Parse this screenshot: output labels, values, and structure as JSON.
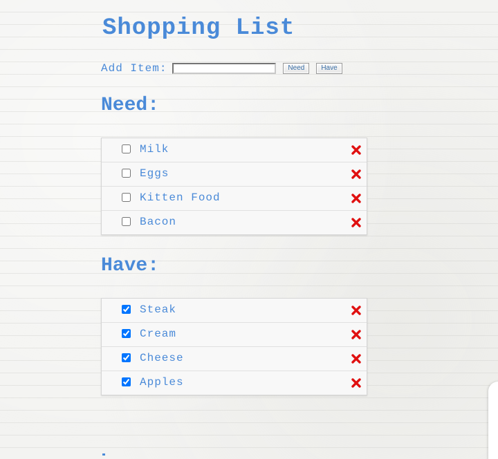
{
  "title": "Shopping List",
  "add_form": {
    "label": "Add Item:",
    "input_value": "",
    "need_button": "Need",
    "have_button": "Have"
  },
  "need": {
    "heading": "Need:",
    "items": [
      {
        "label": "Milk",
        "checked": false
      },
      {
        "label": "Eggs",
        "checked": false
      },
      {
        "label": "Kitten Food",
        "checked": false
      },
      {
        "label": "Bacon",
        "checked": false
      }
    ]
  },
  "have": {
    "heading": "Have:",
    "items": [
      {
        "label": "Steak",
        "checked": true
      },
      {
        "label": "Cream",
        "checked": true
      },
      {
        "label": "Cheese",
        "checked": true
      },
      {
        "label": "Apples",
        "checked": true
      }
    ]
  },
  "icons": {
    "delete": "delete-x-icon"
  },
  "colors": {
    "text_blue": "#4a8ad8",
    "delete_red": "#e01010",
    "paper": "#f3f3f1"
  }
}
